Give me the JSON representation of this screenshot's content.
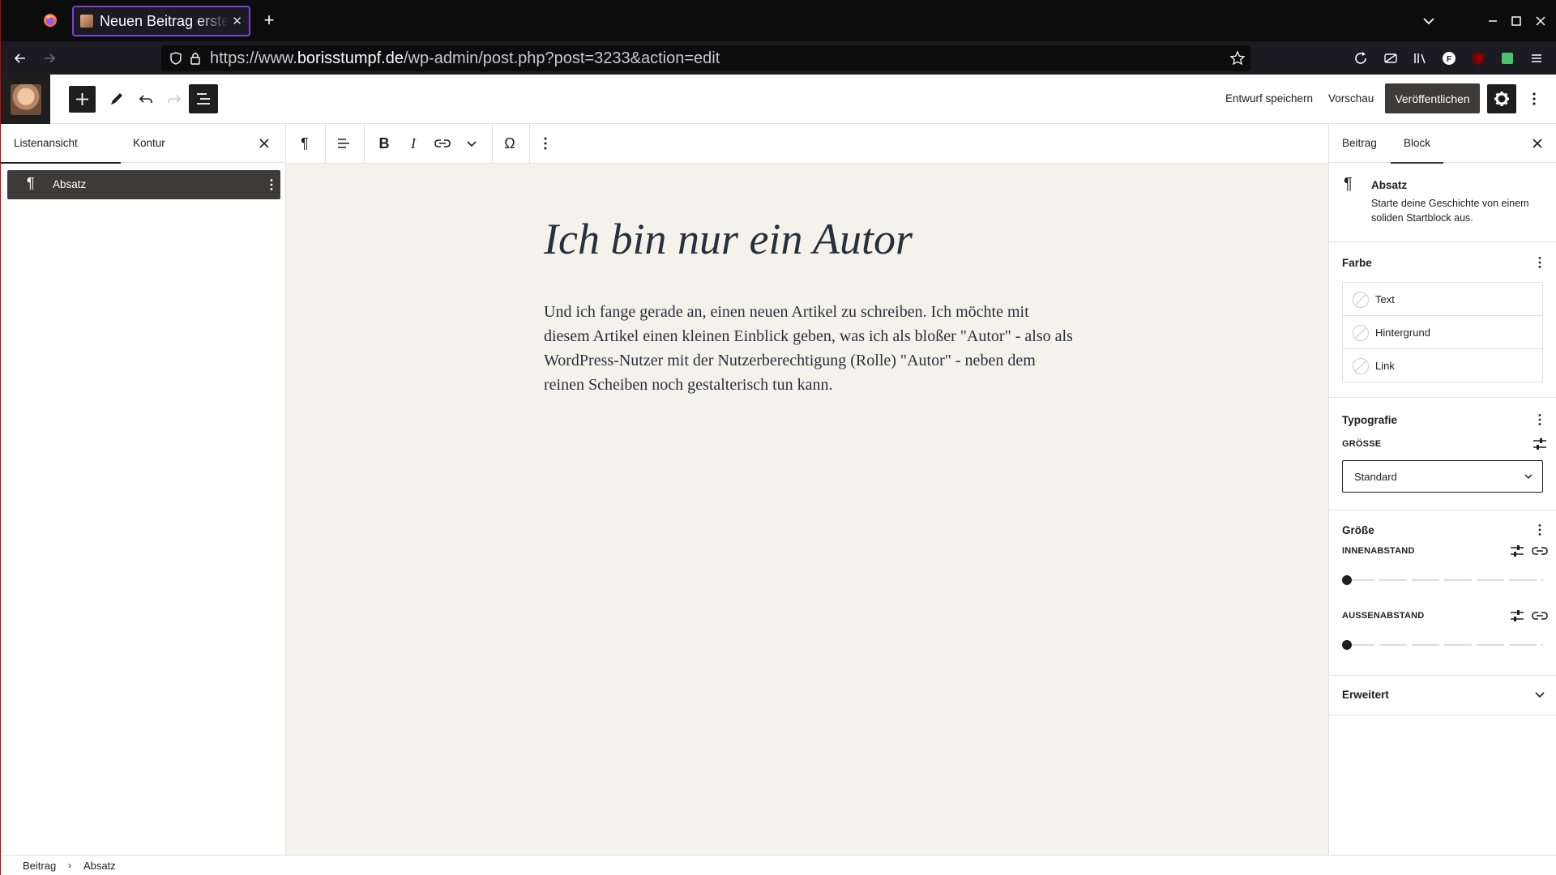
{
  "browser": {
    "tab_title": "Neuen Beitrag erstellen",
    "url_prefix": "https://www.",
    "url_domain": "borisstumpf.de",
    "url_path": "/wp-admin/post.php?post=3233&action=edit"
  },
  "header": {
    "save_draft_label": "Entwurf speichern",
    "preview_label": "Vorschau",
    "publish_label": "Veröffentlichen"
  },
  "left_panel": {
    "tabs": [
      {
        "label": "Listenansicht"
      },
      {
        "label": "Kontur"
      }
    ],
    "items": [
      {
        "label": "Absatz"
      }
    ]
  },
  "editor": {
    "title": "Ich bin nur ein Autor",
    "paragraph": "Und ich fange gerade an, einen neuen Artikel zu schreiben. Ich möchte mit diesem Artikel einen kleinen Einblick geben, was ich als bloßer \"Autor\" - also als WordPress-Nutzer mit der Nutzerberechtigung (Rolle) \"Autor\" - neben dem reinen Scheiben noch gestalterisch tun kann."
  },
  "sidebar": {
    "tabs": [
      {
        "label": "Beitrag"
      },
      {
        "label": "Block"
      }
    ],
    "block": {
      "name": "Absatz",
      "description": "Starte deine Geschichte von einem soliden Startblock aus."
    },
    "color": {
      "title": "Farbe",
      "options": [
        "Text",
        "Hintergrund",
        "Link"
      ]
    },
    "typography": {
      "title": "Typografie",
      "size_label": "GRÖSSE",
      "size_value": "Standard"
    },
    "dimensions": {
      "title": "Größe",
      "padding_label": "INNENABSTAND",
      "padding_value": 0,
      "margin_label": "AUSSENABSTAND",
      "margin_value": 0
    },
    "advanced": {
      "title": "Erweitert"
    }
  },
  "footer": {
    "breadcrumbs": [
      "Beitrag",
      "Absatz"
    ]
  },
  "colors": {
    "canvas_bg": "#f5f2ec",
    "dark": "#1e1e1e",
    "publish_bg": "#3d3a37",
    "tab_accent": "#7b3fe4"
  }
}
